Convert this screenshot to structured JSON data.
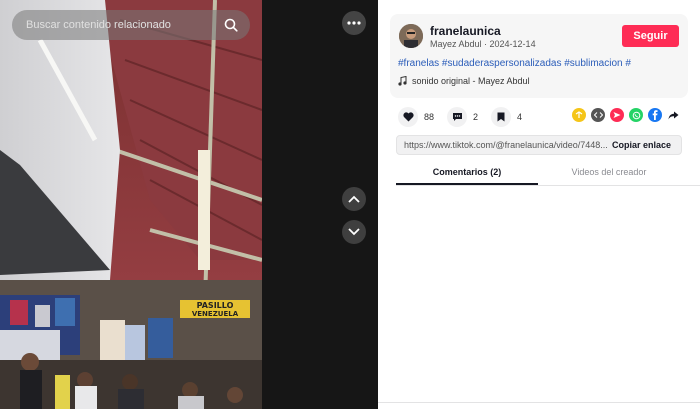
{
  "search": {
    "placeholder": "Buscar contenido relacionado"
  },
  "video": {
    "banner_text_1": "PASILLO",
    "banner_text_2": "VENEZUELA"
  },
  "author": {
    "username": "franelaunica",
    "display_name": "Mayez Abdul",
    "date": "2024-12-14",
    "separator": " · "
  },
  "follow_label": "Seguir",
  "caption": {
    "hashtags": "#franelas #sudaderaspersonalizadas #sublimacion #"
  },
  "sound": {
    "label": "sonido original - Mayez Abdul"
  },
  "stats": {
    "likes": "88",
    "comments": "2",
    "saves": "4"
  },
  "share_icons": [
    "repost-icon",
    "embed-icon",
    "send-icon",
    "whatsapp-icon",
    "facebook-icon",
    "share-arrow-icon"
  ],
  "share_colors": {
    "repost": "#f5c518",
    "embed": "#555555",
    "send": "#fe2c55",
    "whatsapp": "#25d366",
    "facebook": "#1877f2"
  },
  "link": {
    "url": "https://www.tiktok.com/@franelaunica/video/7448...",
    "copy_label": "Copiar enlace"
  },
  "tabs": {
    "comments": "Comentarios (2)",
    "creator_videos": "Videos del creador"
  },
  "colors": {
    "accent": "#fe2c55",
    "hashtag": "#2b5db9"
  }
}
